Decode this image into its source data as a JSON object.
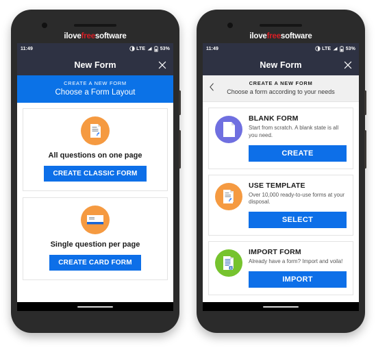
{
  "watermark": {
    "part1": "ilove",
    "part2": "free",
    "part3": "software",
    "accent": "#d81f26"
  },
  "theme": {
    "statusbar_bg": "#2e3243",
    "appbar_bg": "#2e3243",
    "primary_blue": "#0d6fe8",
    "header_blue": "#0b72e7",
    "icon_orange": "#f59a41",
    "icon_purple": "#6f6fe0",
    "icon_green": "#76c32e",
    "subheader_gray": "#f0f0f0"
  },
  "statusbar": {
    "time": "11:49",
    "network": "LTE",
    "battery": "53%",
    "icons": [
      "contrast-icon",
      "signal-icon",
      "battery-icon"
    ]
  },
  "appbar": {
    "title": "New Form",
    "close_label": "close-icon"
  },
  "phone_left": {
    "subheader": {
      "kicker": "CREATE A NEW FORM",
      "title": "Choose a Form Layout"
    },
    "cards": [
      {
        "icon": "document-page-icon",
        "label": "All questions on one page",
        "button": "CREATE CLASSIC FORM"
      },
      {
        "icon": "card-stack-icon",
        "label": "Single question per page",
        "button": "CREATE CARD FORM"
      }
    ]
  },
  "phone_right": {
    "subheader": {
      "back": "back-chevron-icon",
      "kicker": "CREATE A NEW FORM",
      "title": "Choose a form according to your needs"
    },
    "options": [
      {
        "icon": "blank-document-icon",
        "title": "BLANK FORM",
        "desc": "Start from scratch. A blank state is all you need.",
        "button": "CREATE"
      },
      {
        "icon": "template-document-icon",
        "title": "USE TEMPLATE",
        "desc": "Over 10,000 ready-to-use forms at your disposal.",
        "button": "SELECT"
      },
      {
        "icon": "import-document-icon",
        "title": "IMPORT FORM",
        "desc": "Already have a form? Import and voila!",
        "button": "IMPORT"
      }
    ]
  }
}
